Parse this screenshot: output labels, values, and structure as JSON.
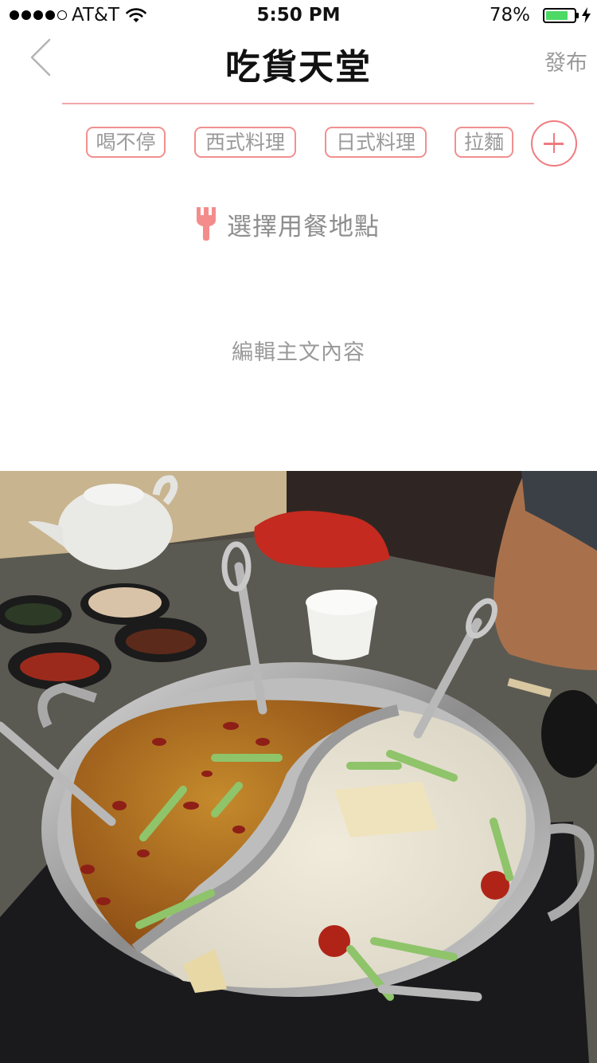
{
  "status_bar": {
    "carrier": "AT&T",
    "time": "5:50 PM",
    "battery_percent": "78%",
    "battery_level": 0.78,
    "signal_bars": 4,
    "signal_max": 5
  },
  "nav": {
    "title": "吃貨天堂",
    "publish_label": "發布",
    "back_icon": "chevron-left-icon"
  },
  "tags": [
    {
      "label": "喝不停"
    },
    {
      "label": "西式料理"
    },
    {
      "label": "日式料理"
    },
    {
      "label": "拉麵"
    }
  ],
  "add_tag_icon": "plus-circle-icon",
  "location": {
    "icon": "fork-icon",
    "label": "選擇用餐地點"
  },
  "content": {
    "placeholder": "編輯主文內容"
  },
  "colors": {
    "accent": "#f07b80",
    "underline": "#f3a6a9",
    "muted_text": "#9a9a9a",
    "battery": "#4cd964"
  }
}
